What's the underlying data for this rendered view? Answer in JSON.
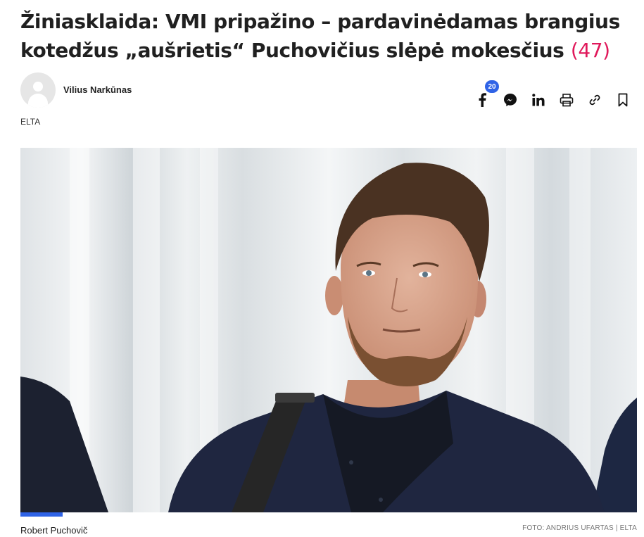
{
  "article": {
    "title": "Žiniasklaida: VMI pripažino – pardavinėdamas brangius kotedžus „aušrietis“ Puchovičius slėpė mokesčius",
    "comment_count": "(47)",
    "author": "Vilius Narkūnas",
    "source": "ELTA"
  },
  "share": {
    "facebook_count": "20",
    "icons": [
      "facebook-icon",
      "messenger-icon",
      "linkedin-icon",
      "print-icon",
      "link-icon",
      "bookmark-icon"
    ]
  },
  "photo": {
    "caption": "Robert Puchovič",
    "credit": "FOTO: ANDRIUS UFARTAS | ELTA"
  },
  "colors": {
    "accent": "#2f63e6",
    "comment_count": "#e0195b"
  }
}
